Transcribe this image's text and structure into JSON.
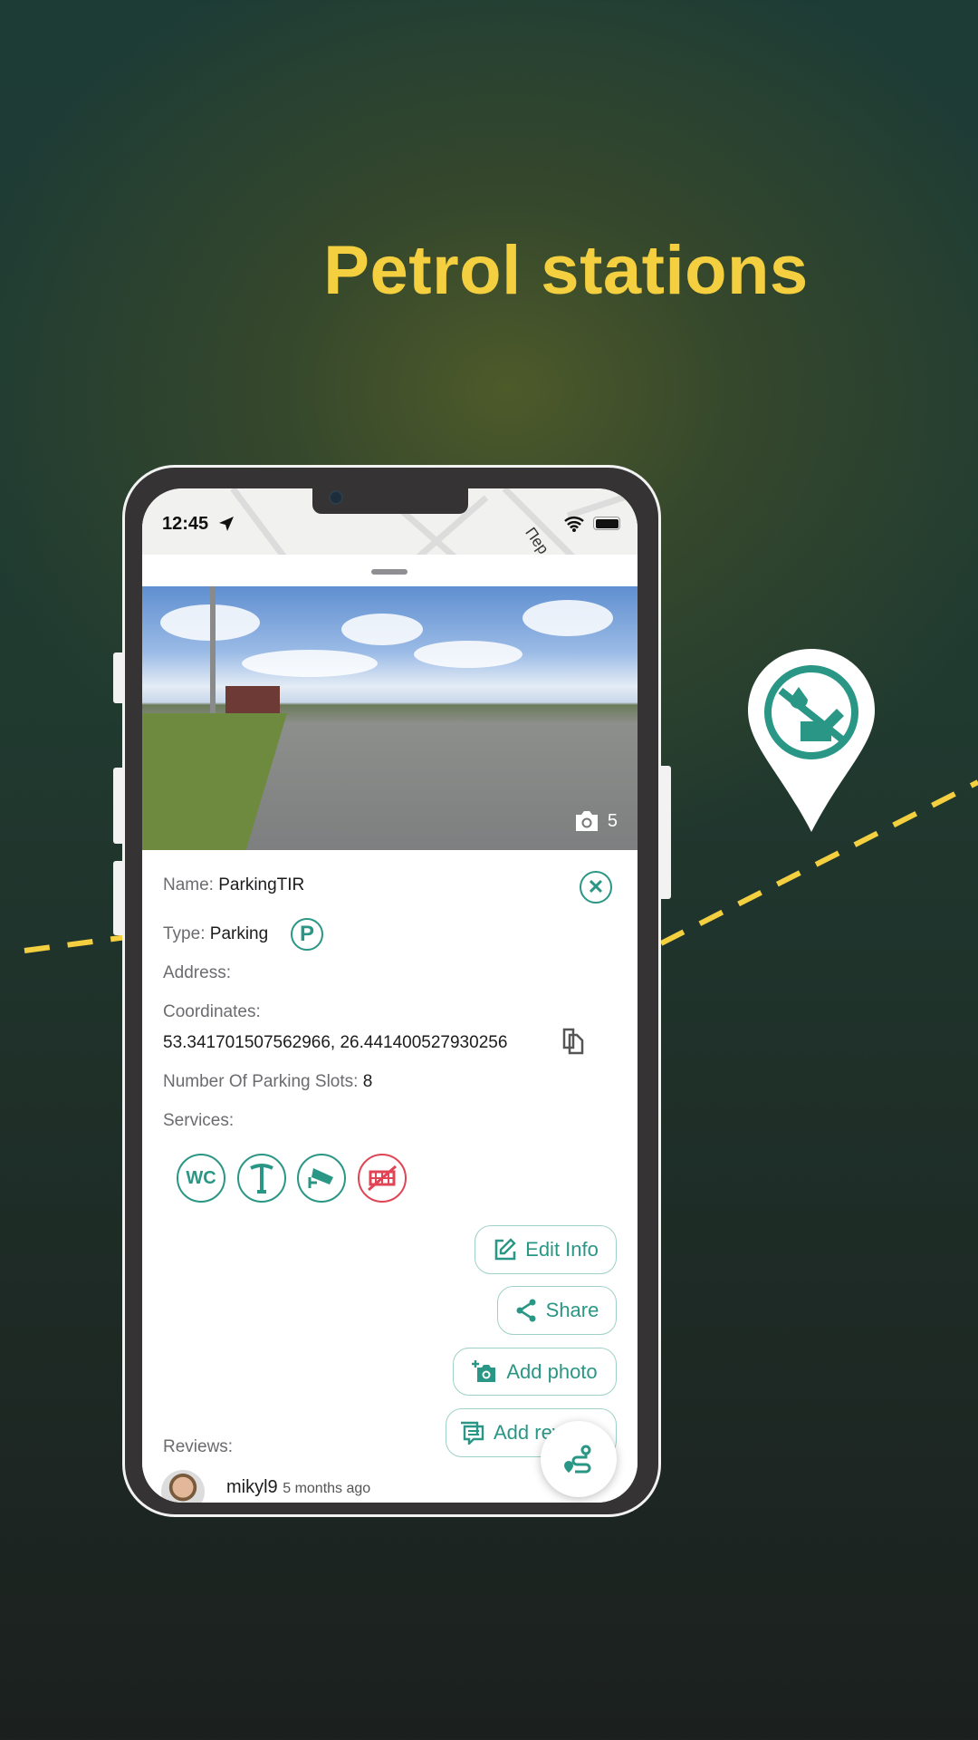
{
  "headline": "Petrol stations",
  "colors": {
    "accent": "#2a9685",
    "headline": "#f4cf3f",
    "danger": "#e04455",
    "route_dash": "#f4cf3f"
  },
  "status_bar": {
    "time": "12:45",
    "icons": [
      "location-arrow-icon",
      "wifi-icon",
      "battery-icon"
    ]
  },
  "map": {
    "street_label": "Пер"
  },
  "photo": {
    "count": "5",
    "icon": "camera-icon"
  },
  "details": {
    "name_label": "Name:",
    "name_value": "ParkingTIR",
    "type_label": "Type:",
    "type_value": "Parking",
    "type_icon": "parking-icon",
    "address_label": "Address:",
    "coordinates_label": "Coordinates:",
    "coordinates_value": "53.341701507562966, 26.441400527930256",
    "slots_label": "Number Of Parking Slots:",
    "slots_value": "8",
    "services_label": "Services:",
    "services": [
      {
        "icon": "wc-icon",
        "wc_text": "WC",
        "available": true
      },
      {
        "icon": "street-light-icon",
        "available": true
      },
      {
        "icon": "security-camera-icon",
        "available": true
      },
      {
        "icon": "fence-icon",
        "available": false
      }
    ]
  },
  "actions": {
    "edit": "Edit Info",
    "share": "Share",
    "add_photo": "Add photo",
    "add_review": "Add review"
  },
  "reviews": {
    "label": "Reviews:",
    "items": [
      {
        "user": "mikyl9",
        "time": "5 months ago"
      }
    ]
  },
  "marker": {
    "icon": "no-fuel-icon"
  }
}
